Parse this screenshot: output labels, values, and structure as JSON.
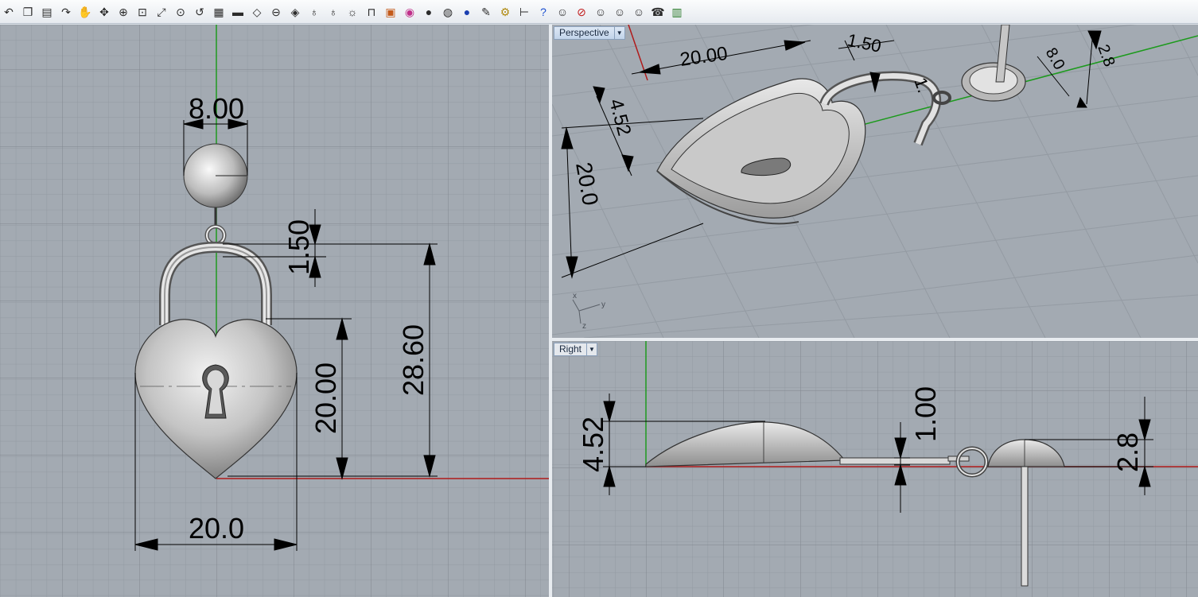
{
  "toolbar": {
    "icons": [
      "undo-icon",
      "copy-icon",
      "clipboard-icon",
      "redo-icon",
      "pan-hand-icon",
      "rotate-view-icon",
      "zoom-icon",
      "zoom-window-icon",
      "zoom-extents-icon",
      "zoom-selected-icon",
      "zoom-previous-icon",
      "grid-icon",
      "car-icon",
      "plane-icon",
      "cplane-icon",
      "object-snap-icon",
      "light-bulb-icon",
      "light-bulb-2-icon",
      "light-bulb-3-icon",
      "lock-icon",
      "render-box-icon",
      "color-wheel-icon",
      "shaded-sphere-icon",
      "rendered-sphere-icon",
      "blue-sphere-icon",
      "pencil-icon",
      "gear-icon",
      "dimension-icon",
      "help-icon",
      "face-1-icon",
      "no-entry-icon",
      "face-2-icon",
      "face-3-icon",
      "face-4-icon",
      "phone-icon",
      "film-icon"
    ]
  },
  "viewports": {
    "front": {
      "dims": {
        "top_width": "8.00",
        "gap": "1.50",
        "heart_height": "20.00",
        "total_height": "28.60",
        "heart_width": "20.0"
      }
    },
    "perspective": {
      "label": "Perspective",
      "dims": {
        "length": "20.00",
        "gap": "1.50",
        "gap_partial": "1.",
        "height": "4.52",
        "width": "20.0",
        "post_dia": "8.0",
        "post_height": "2.8"
      },
      "axis": {
        "x": "x",
        "y": "y",
        "z": "z"
      }
    },
    "right": {
      "label": "Right",
      "dims": {
        "height": "4.52",
        "thickness": "1.00",
        "post_height": "2.8"
      }
    }
  },
  "colors": {
    "viewport_bg": "#a3aab2",
    "grid_minor": "#8f969e",
    "grid_major": "#7d848c",
    "axis_x": "#b01b1b",
    "axis_y": "#1c9a1c"
  }
}
